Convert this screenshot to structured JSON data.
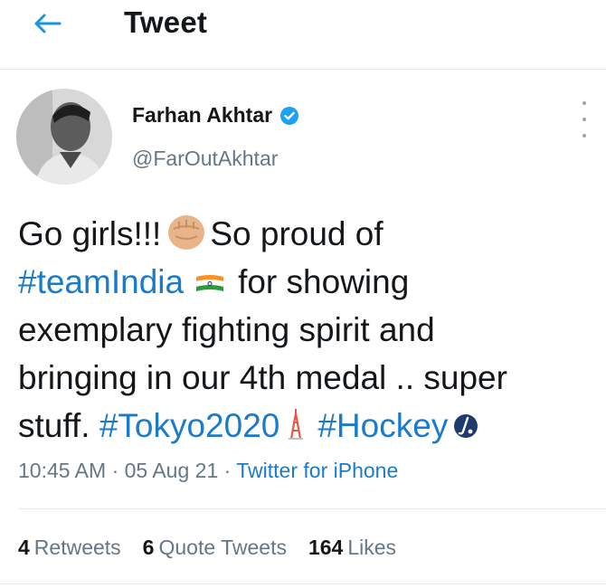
{
  "header": {
    "title": "Tweet"
  },
  "author": {
    "name": "Farhan Akhtar",
    "handle": "@FarOutAkhtar",
    "verified": true
  },
  "tweet": {
    "lines": [
      {
        "parts": [
          {
            "type": "text",
            "value": "Go girls!!!"
          },
          {
            "type": "emoji",
            "name": "raised-fist-icon"
          },
          {
            "type": "text",
            "value": "So proud of"
          }
        ]
      },
      {
        "parts": [
          {
            "type": "hashtag",
            "value": "#teamIndia"
          },
          {
            "type": "emoji",
            "name": "india-flag-icon"
          },
          {
            "type": "text",
            "value": "for showing"
          }
        ]
      },
      {
        "parts": [
          {
            "type": "text",
            "value": "exemplary fighting spirit and"
          }
        ]
      },
      {
        "parts": [
          {
            "type": "text",
            "value": "bringing in our 4th medal .. super"
          }
        ]
      },
      {
        "parts": [
          {
            "type": "text",
            "value": "stuff. "
          },
          {
            "type": "hashtag",
            "value": "#Tokyo2020"
          },
          {
            "type": "emoji",
            "name": "tokyo-tower-icon"
          },
          {
            "type": "hashtag",
            "value": "#Hockey"
          },
          {
            "type": "emoji",
            "name": "field-hockey-icon"
          }
        ]
      }
    ]
  },
  "meta": {
    "time": "10:45 AM",
    "separator": " · ",
    "date": "05 Aug 21",
    "source": "Twitter for iPhone"
  },
  "stats": {
    "retweets": {
      "count": "4",
      "label": "Retweets"
    },
    "quote_tweets": {
      "count": "6",
      "label": "Quote Tweets"
    },
    "likes": {
      "count": "164",
      "label": "Likes"
    }
  },
  "colors": {
    "accent": "#1b7bcb",
    "secondary_text": "#657786",
    "primary_text": "#14171a",
    "divider": "#e6ecf0"
  }
}
